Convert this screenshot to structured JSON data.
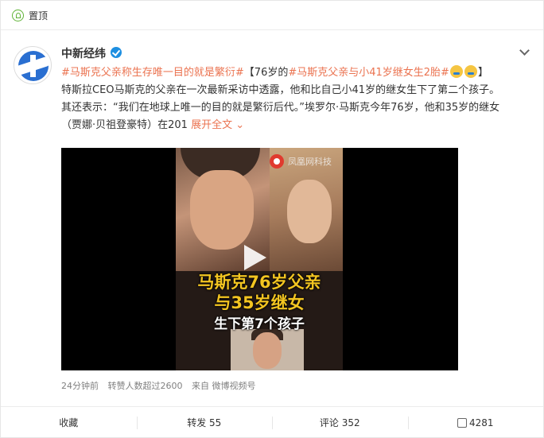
{
  "pin": {
    "label": "置顶",
    "icon": "pin-icon"
  },
  "author": {
    "name": "中新经纬",
    "verified_icon": "verified-icon",
    "avatar_icon": "avatar"
  },
  "post": {
    "hashtag1": "#马斯克父亲称生存唯一目的就是繁衍#",
    "bracket_open": "【76岁的",
    "hashtag2": "#马斯克父亲与小41岁继女生2胎#",
    "bracket_close": "】",
    "line2": "特斯拉CEO马斯克的父亲在一次最新采访中透露，他和比自己小41岁的继女生下了第二个孩子。",
    "line3": "其还表示：“我们在地球上唯一的目的就是繁衍后代。”埃罗尔·马斯克今年76岁，他和35岁的继女",
    "line4": "（贾娜·贝祖登豪特）在201",
    "expand": "展开全文",
    "expand_icon": "chevron-down-icon"
  },
  "video": {
    "watermark": "凤凰网科技",
    "caption1": "马斯克76岁父亲",
    "caption2": "与35岁继女",
    "caption3": "生下第7个孩子"
  },
  "meta": {
    "time": "24分钟前",
    "reposts": "转赞人数超过2600",
    "source": "来自 微博视频号"
  },
  "actions": {
    "favorite": "收藏",
    "repost": "转发 55",
    "comment": "评论 352",
    "like": "4281"
  },
  "colors": {
    "accent": "#eb7350",
    "pin": "#5fb336",
    "verified": "#1e8fe1",
    "caption": "#f3c521"
  }
}
